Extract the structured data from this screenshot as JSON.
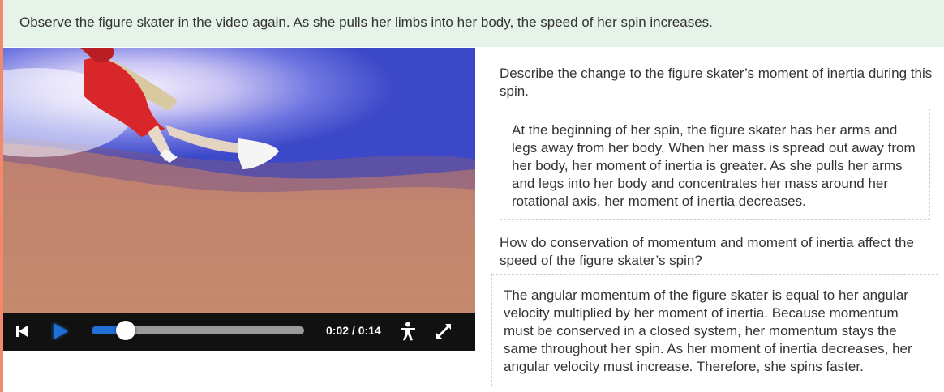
{
  "prompt": {
    "text": "Observe the figure skater in the video again. As she pulls her limbs into her body, the speed of her spin increases."
  },
  "video": {
    "time_display": "0:02 / 0:14",
    "progress": 0.16,
    "icons": {
      "restart": "skip-back-icon",
      "play": "play-icon",
      "accessibility": "accessibility-icon",
      "fullscreen": "fullscreen-icon"
    }
  },
  "questions": [
    {
      "prompt": "Describe the change to the figure skater’s moment of inertia during this spin.",
      "answer": "At the beginning of her spin, the figure skater has her arms and legs away from her body. When her mass is spread out away from her body, her moment of inertia is greater. As she pulls her arms and legs into her body and concentrates her mass around her rotational axis, her moment of inertia decreases."
    },
    {
      "prompt": "How do conservation of momentum and moment of inertia affect the speed of the figure skater’s spin?",
      "answer": "The angular momentum of the figure skater is equal to her angular velocity multiplied by her moment of inertia. Because momentum must be conserved in a closed system, her momentum stays the same throughout her spin. As her moment of inertia decreases, her angular velocity must increase. Therefore, she spins faster."
    }
  ],
  "colors": {
    "prompt_bg": "#e6f3e9",
    "accent": "#f08a6b",
    "progress": "#1f6fd6"
  }
}
